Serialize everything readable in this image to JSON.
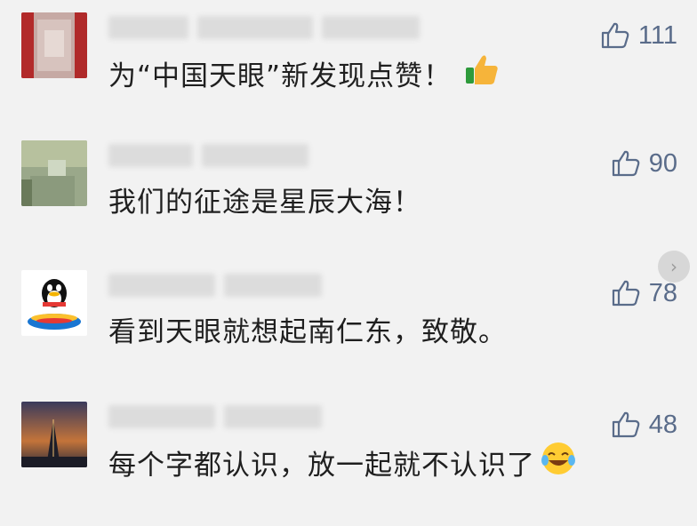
{
  "comments": [
    {
      "text": "为“中国天眼”新发现点赞！",
      "likes": "111",
      "emoji": "thumbs-up-emoji"
    },
    {
      "text": "我们的征途是星辰大海！",
      "likes": "90"
    },
    {
      "text": "看到天眼就想起南仁东，致敬。",
      "likes": "78"
    },
    {
      "text": "每个字都认识，放一起就不认识了",
      "likes": "48",
      "emoji": "laughing-tears-emoji"
    }
  ],
  "icons": {
    "like": "thumb-up-outline-icon",
    "scroll": "chevron-right-icon"
  },
  "colors": {
    "background": "#f2f2f2",
    "like": "#5a6c8a",
    "text": "#1f1f1f"
  }
}
